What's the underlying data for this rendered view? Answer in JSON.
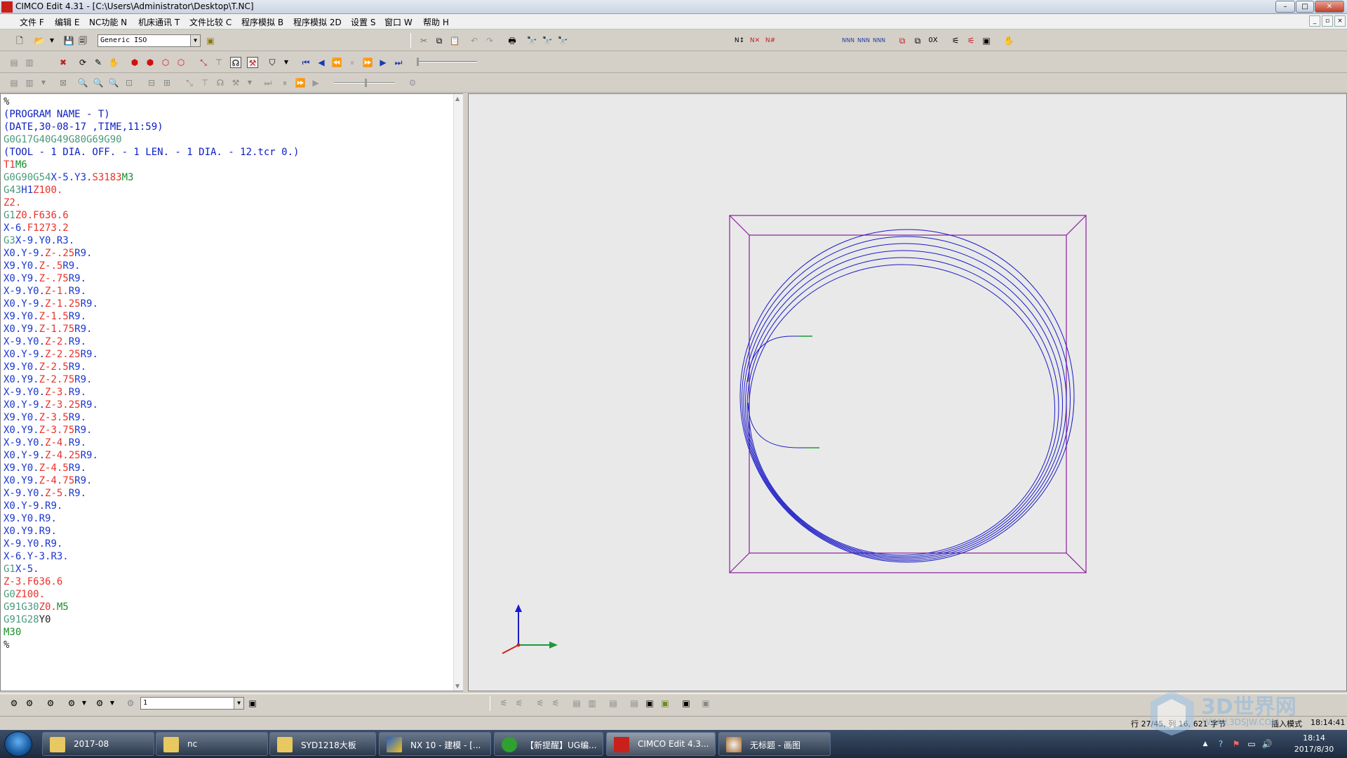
{
  "window": {
    "title": "CIMCO Edit 4.31 - [C:\\Users\\Administrator\\Desktop\\T.NC]",
    "minimize": "–",
    "maximize": "□",
    "close": "✕"
  },
  "menu": [
    "文件 F",
    "编辑 E",
    "NC功能 N",
    "机床通讯 T",
    "文件比较 C",
    "程序模拟 B",
    "程序模拟 2D",
    "设置 S",
    "窗口 W",
    "帮助 H"
  ],
  "toolbar": {
    "machine_combo": "Generic ISO",
    "find_combo": "1"
  },
  "editor_lines": [
    [
      [
        "%",
        "ck"
      ]
    ],
    [
      [
        "(PROGRAM NAME - T)",
        "ctxt"
      ]
    ],
    [
      [
        "(DATE,30-08-17 ,TIME,11:59)",
        "ctxt"
      ]
    ],
    [
      [
        "G0G17G40G49G80G69G90",
        "cg"
      ]
    ],
    [
      [
        "(TOOL - 1 DIA. OFF. - 1 LEN. - 1 DIA. - 12.tcr 0.)",
        "ctxt"
      ]
    ],
    [
      [
        "T1",
        "cr"
      ],
      [
        "M6",
        "cgr"
      ]
    ],
    [
      [
        "G0G90G54",
        "cg"
      ],
      [
        "X-5.",
        "cb"
      ],
      [
        "Y3.",
        "cb"
      ],
      [
        "S3183",
        "cr"
      ],
      [
        "M3",
        "cgr"
      ]
    ],
    [
      [
        "G43",
        "cg"
      ],
      [
        "H1",
        "cb"
      ],
      [
        "Z100.",
        "cr"
      ]
    ],
    [
      [
        "Z2.",
        "cr"
      ]
    ],
    [
      [
        "G1",
        "cg"
      ],
      [
        "Z0.",
        "cr"
      ],
      [
        "F636.6",
        "cr"
      ]
    ],
    [
      [
        "X-6.",
        "cb"
      ],
      [
        "F1273.2",
        "cr"
      ]
    ],
    [
      [
        "G3",
        "cg"
      ],
      [
        "X-9.",
        "cb"
      ],
      [
        "Y0.",
        "cb"
      ],
      [
        "R3.",
        "cb"
      ]
    ],
    [
      [
        "X0.",
        "cb"
      ],
      [
        "Y-9.",
        "cb"
      ],
      [
        "Z-.25",
        "cr"
      ],
      [
        "R9.",
        "cb"
      ]
    ],
    [
      [
        "X9.",
        "cb"
      ],
      [
        "Y0.",
        "cb"
      ],
      [
        "Z-.5",
        "cr"
      ],
      [
        "R9.",
        "cb"
      ]
    ],
    [
      [
        "X0.",
        "cb"
      ],
      [
        "Y9.",
        "cb"
      ],
      [
        "Z-.75",
        "cr"
      ],
      [
        "R9.",
        "cb"
      ]
    ],
    [
      [
        "X-9.",
        "cb"
      ],
      [
        "Y0.",
        "cb"
      ],
      [
        "Z-1.",
        "cr"
      ],
      [
        "R9.",
        "cb"
      ]
    ],
    [
      [
        "X0.",
        "cb"
      ],
      [
        "Y-9.",
        "cb"
      ],
      [
        "Z-1.25",
        "cr"
      ],
      [
        "R9.",
        "cb"
      ]
    ],
    [
      [
        "X9.",
        "cb"
      ],
      [
        "Y0.",
        "cb"
      ],
      [
        "Z-1.5",
        "cr"
      ],
      [
        "R9.",
        "cb"
      ]
    ],
    [
      [
        "X0.",
        "cb"
      ],
      [
        "Y9.",
        "cb"
      ],
      [
        "Z-1.75",
        "cr"
      ],
      [
        "R9.",
        "cb"
      ]
    ],
    [
      [
        "X-9.",
        "cb"
      ],
      [
        "Y0.",
        "cb"
      ],
      [
        "Z-2.",
        "cr"
      ],
      [
        "R9.",
        "cb"
      ]
    ],
    [
      [
        "X0.",
        "cb"
      ],
      [
        "Y-9.",
        "cb"
      ],
      [
        "Z-2.25",
        "cr"
      ],
      [
        "R9.",
        "cb"
      ]
    ],
    [
      [
        "X9.",
        "cb"
      ],
      [
        "Y0.",
        "cb"
      ],
      [
        "Z-2.5",
        "cr"
      ],
      [
        "R9.",
        "cb"
      ]
    ],
    [
      [
        "X0.",
        "cb"
      ],
      [
        "Y9.",
        "cb"
      ],
      [
        "Z-2.75",
        "cr"
      ],
      [
        "R9.",
        "cb"
      ]
    ],
    [
      [
        "X-9.",
        "cb"
      ],
      [
        "Y0.",
        "cb"
      ],
      [
        "Z-3.",
        "cr"
      ],
      [
        "R9.",
        "cb"
      ]
    ],
    [
      [
        "X0.",
        "cb"
      ],
      [
        "Y-9.",
        "cb"
      ],
      [
        "Z-3.25",
        "cr"
      ],
      [
        "R9.",
        "cb"
      ]
    ],
    [
      [
        "X9.",
        "cb"
      ],
      [
        "Y0.",
        "cb"
      ],
      [
        "Z-3.5",
        "cr"
      ],
      [
        "R9.",
        "cb"
      ]
    ],
    [
      [
        "X0.",
        "cb"
      ],
      [
        "Y9.",
        "cb"
      ],
      [
        "Z-3.75",
        "cr"
      ],
      [
        "R9.",
        "cb"
      ]
    ],
    [
      [
        "X-9.",
        "cb"
      ],
      [
        "Y0.",
        "cb"
      ],
      [
        "Z-4.",
        "cr"
      ],
      [
        "R9.",
        "cb"
      ]
    ],
    [
      [
        "X0.",
        "cb"
      ],
      [
        "Y-9.",
        "cb"
      ],
      [
        "Z-4.25",
        "cr"
      ],
      [
        "R9.",
        "cb"
      ]
    ],
    [
      [
        "X9.",
        "cb"
      ],
      [
        "Y0.",
        "cb"
      ],
      [
        "Z-4.5",
        "cr"
      ],
      [
        "R9.",
        "cb"
      ]
    ],
    [
      [
        "X0.",
        "cb"
      ],
      [
        "Y9.",
        "cb"
      ],
      [
        "Z-4.75",
        "cr"
      ],
      [
        "R9.",
        "cb"
      ]
    ],
    [
      [
        "X-9.",
        "cb"
      ],
      [
        "Y0.",
        "cb"
      ],
      [
        "Z-5.",
        "cr"
      ],
      [
        "R9.",
        "cb"
      ]
    ],
    [
      [
        "X0.",
        "cb"
      ],
      [
        "Y-9.",
        "cb"
      ],
      [
        "R9.",
        "cb"
      ]
    ],
    [
      [
        "X9.",
        "cb"
      ],
      [
        "Y0.",
        "cb"
      ],
      [
        "R9.",
        "cb"
      ]
    ],
    [
      [
        "X0.",
        "cb"
      ],
      [
        "Y9.",
        "cb"
      ],
      [
        "R9.",
        "cb"
      ]
    ],
    [
      [
        "X-9.",
        "cb"
      ],
      [
        "Y0.",
        "cb"
      ],
      [
        "R9.",
        "cb"
      ]
    ],
    [
      [
        "X-6.",
        "cb"
      ],
      [
        "Y-3.",
        "cb"
      ],
      [
        "R3.",
        "cb"
      ]
    ],
    [
      [
        "G1",
        "cg"
      ],
      [
        "X-5.",
        "cb"
      ]
    ],
    [
      [
        "Z-3.",
        "cr"
      ],
      [
        "F636.6",
        "cr"
      ]
    ],
    [
      [
        "G0",
        "cg"
      ],
      [
        "Z100.",
        "cr"
      ]
    ],
    [
      [
        "G91G30",
        "cg"
      ],
      [
        "Z0.",
        "cr"
      ],
      [
        "M5",
        "cgr"
      ]
    ],
    [
      [
        "G91G28",
        "cg"
      ],
      [
        "Y0",
        "ck"
      ]
    ],
    [
      [
        "M30",
        "cgr"
      ]
    ],
    [
      [
        "%",
        "ck"
      ]
    ]
  ],
  "status": {
    "position": "行 27/45, 列 16, 621 字节",
    "mode": "插入模式",
    "time": "18:14:41"
  },
  "taskbar": {
    "items": [
      "2017-08",
      "nc",
      "SYD1218大板",
      "NX 10 - 建模 - [...",
      "【新提醒】UG编...",
      "CIMCO Edit 4.3...",
      "无标题 - 画图"
    ],
    "clock_time": "18:14",
    "clock_date": "2017/8/30"
  },
  "watermark": {
    "brand": "3D世界网",
    "url": "WWW.3DSJW.COM"
  },
  "colors": {
    "toolpath": "#1a1ac8",
    "stock": "#8a1e9a",
    "axis_x": "#1a9a3a",
    "axis_z": "#1a1ac8"
  }
}
